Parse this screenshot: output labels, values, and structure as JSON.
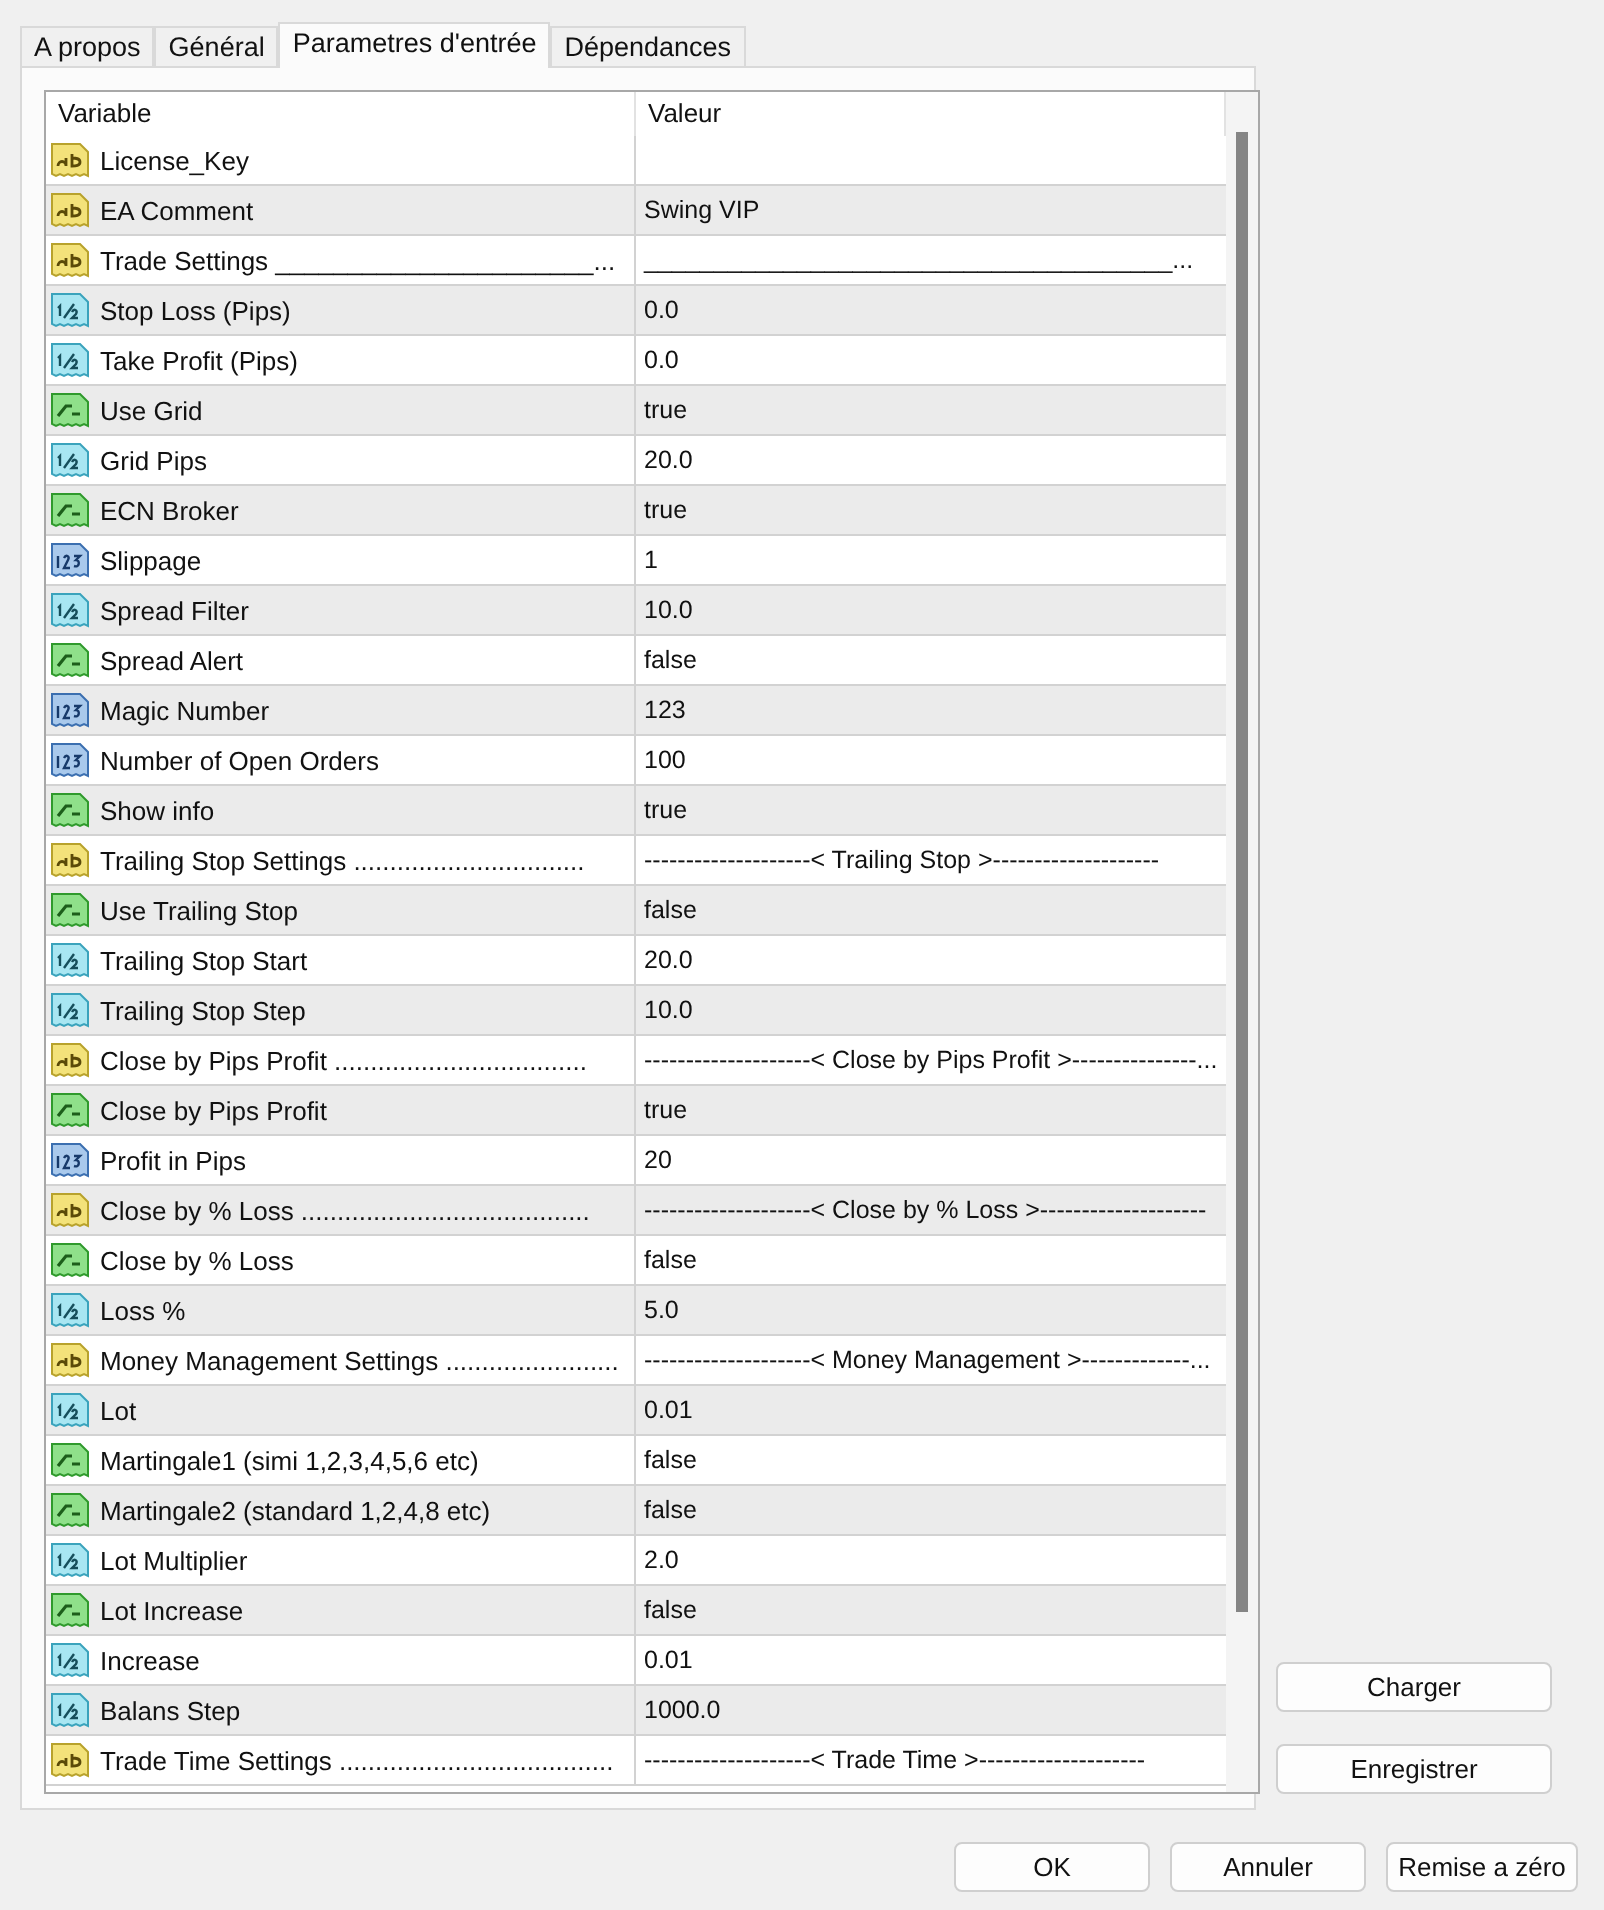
{
  "tabs": [
    {
      "label": "A propos",
      "selected": false
    },
    {
      "label": "Général",
      "selected": false
    },
    {
      "label": "Parametres d'entrée",
      "selected": true
    },
    {
      "label": "Dépendances",
      "selected": false
    }
  ],
  "table": {
    "columns": [
      "Variable",
      "Valeur"
    ],
    "rows": [
      {
        "kind": "string",
        "variable": "License_Key"
      },
      {
        "kind": "string",
        "variable": "EA Comment",
        "value": "Swing VIP"
      },
      {
        "kind": "string",
        "variable": "Trade Settings ______________________...",
        "value": "______________________________________..."
      },
      {
        "kind": "double",
        "variable": "Stop Loss (Pips)",
        "value": "0.0"
      },
      {
        "kind": "double",
        "variable": "Take Profit (Pips)",
        "value": "0.0"
      },
      {
        "kind": "bool",
        "variable": "Use Grid",
        "value": "true"
      },
      {
        "kind": "double",
        "variable": "Grid Pips",
        "value": "20.0"
      },
      {
        "kind": "bool",
        "variable": "ECN Broker",
        "value": "true"
      },
      {
        "kind": "int",
        "variable": "Slippage",
        "value": "1"
      },
      {
        "kind": "double",
        "variable": "Spread Filter",
        "value": "10.0"
      },
      {
        "kind": "bool",
        "variable": "Spread Alert",
        "value": "false"
      },
      {
        "kind": "int",
        "variable": "Magic Number",
        "value": "123"
      },
      {
        "kind": "int",
        "variable": "Number of Open Orders",
        "value": "100"
      },
      {
        "kind": "bool",
        "variable": "Show info",
        "value": "true"
      },
      {
        "kind": "string",
        "variable": "Trailing Stop Settings ................................",
        "value": "--------------------< Trailing Stop >--------------------"
      },
      {
        "kind": "bool",
        "variable": "Use Trailing Stop",
        "value": "false"
      },
      {
        "kind": "double",
        "variable": "Trailing Stop Start",
        "value": "20.0"
      },
      {
        "kind": "double",
        "variable": "Trailing Stop Step",
        "value": "10.0"
      },
      {
        "kind": "string",
        "variable": "Close by Pips Profit ...................................",
        "value": "--------------------< Close by Pips Profit >---------------..."
      },
      {
        "kind": "bool",
        "variable": "Close by Pips Profit",
        "value": "true"
      },
      {
        "kind": "int",
        "variable": "Profit in Pips",
        "value": "20"
      },
      {
        "kind": "string",
        "variable": "Close by % Loss ........................................",
        "value": "--------------------< Close by % Loss >--------------------"
      },
      {
        "kind": "bool",
        "variable": "Close by % Loss",
        "value": "false"
      },
      {
        "kind": "double",
        "variable": "Loss %",
        "value": "5.0"
      },
      {
        "kind": "string",
        "variable": "Money Management Settings ........................",
        "value": "--------------------< Money Management >-------------..."
      },
      {
        "kind": "double",
        "variable": "Lot",
        "value": "0.01"
      },
      {
        "kind": "bool",
        "variable": "Martingale1 (simi 1,2,3,4,5,6 etc)",
        "value": "false"
      },
      {
        "kind": "bool",
        "variable": "Martingale2 (standard 1,2,4,8 etc)",
        "value": "false"
      },
      {
        "kind": "double",
        "variable": "Lot Multiplier",
        "value": "2.0"
      },
      {
        "kind": "bool",
        "variable": "Lot Increase",
        "value": "false"
      },
      {
        "kind": "double",
        "variable": "Increase",
        "value": "0.01"
      },
      {
        "kind": "double",
        "variable": "Balans Step",
        "value": "1000.0"
      },
      {
        "kind": "string",
        "variable": "Trade Time Settings ......................................",
        "value": "--------------------< Trade Time >--------------------"
      }
    ]
  },
  "side_buttons": [
    "Charger",
    "Enregistrer"
  ],
  "buttons": [
    "OK",
    "Annuler",
    "Remise a zéro"
  ]
}
